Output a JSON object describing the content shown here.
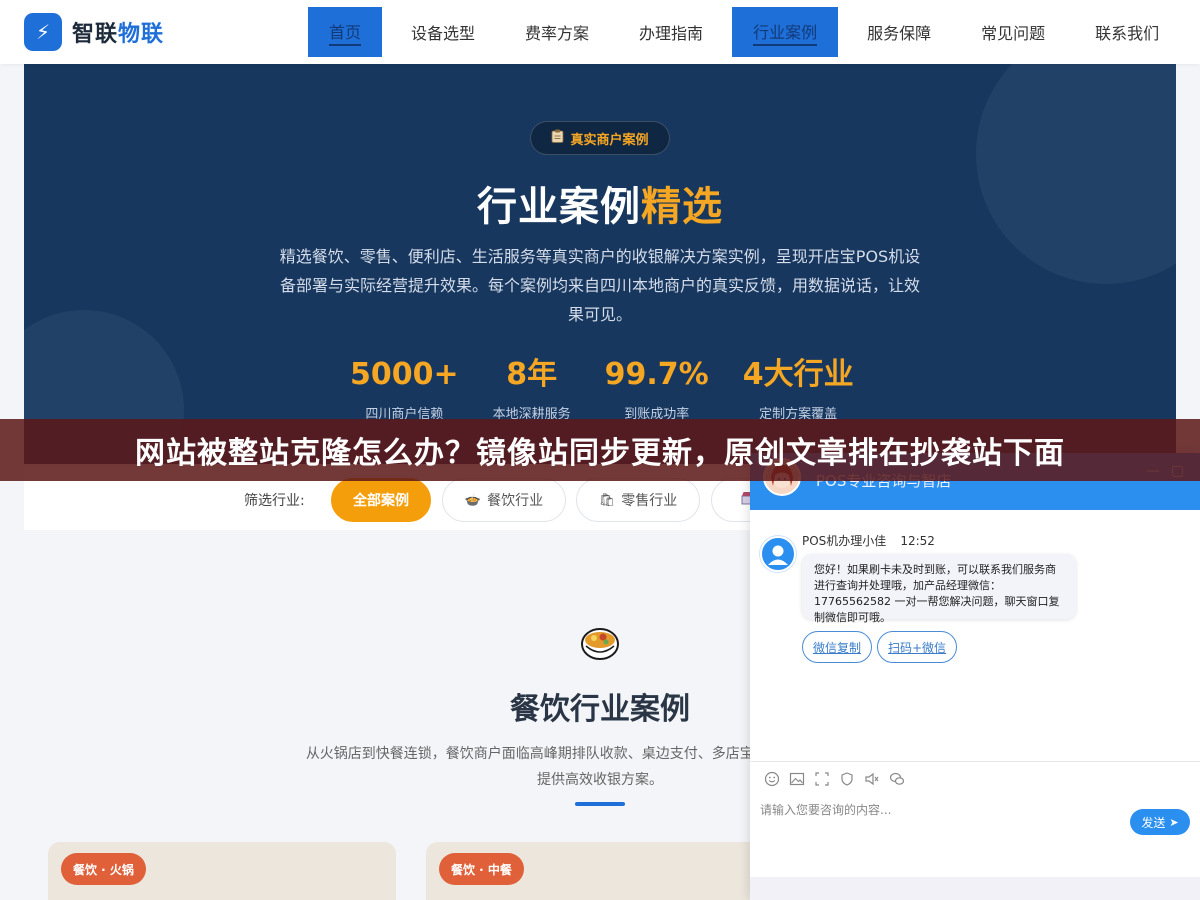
{
  "logo": {
    "mark": "⚡",
    "text_main": "智联",
    "text_accent": "物联"
  },
  "nav": [
    {
      "label": "首页",
      "active": true
    },
    {
      "label": "设备选型",
      "active": false
    },
    {
      "label": "费率方案",
      "active": false
    },
    {
      "label": "办理指南",
      "active": false
    },
    {
      "label": "行业案例",
      "active": true
    },
    {
      "label": "服务保障",
      "active": false
    },
    {
      "label": "常见问题",
      "active": false
    },
    {
      "label": "联系我们",
      "active": false
    }
  ],
  "hero": {
    "badge": "真实商户案例",
    "title_main": "行业案例",
    "title_highlight": "精选",
    "desc": "精选餐饮、零售、便利店、生活服务等真实商户的收银解决方案实例，呈现开店宝POS机设备部署与实际经营提升效果。每个案例均来自四川本地商户的真实反馈，用数据说话，让效果可见。",
    "stats": [
      {
        "value": "5000+",
        "label": "四川商户信赖"
      },
      {
        "value": "8年",
        "label": "本地深耕服务"
      },
      {
        "value": "99.7%",
        "label": "到账成功率"
      },
      {
        "value": "4大行业",
        "label": "定制方案覆盖"
      }
    ]
  },
  "filter": {
    "label": "筛选行业:",
    "chips": [
      {
        "label": "全部案例",
        "icon": "",
        "active": true
      },
      {
        "label": "餐饮行业",
        "icon": "🍲",
        "active": false
      },
      {
        "label": "零售行业",
        "icon": "🛍",
        "active": false
      }
    ]
  },
  "section": {
    "title": "餐饮行业案例",
    "desc": "从火锅店到快餐连锁，餐饮商户面临高峰期排队收款、桌边支付、多店宝POS机为各类餐饮门店提供高效收银方案。"
  },
  "cards": [
    {
      "tag": "餐饮 · 火锅"
    },
    {
      "tag": "餐饮 · 中餐"
    }
  ],
  "banner": {
    "text": "网站被整站克隆怎么办？镜像站同步更新，原创文章排在抄袭站下面"
  },
  "chat": {
    "title": "POS专业咨询与智店",
    "minimize": "—",
    "maximize": "▢",
    "agent_name": "POS机办理小佳",
    "time": "12:52",
    "message": "您好！如果刷卡未及时到账，可以联系我们服务商进行查询并处理哦，加产品经理微信：17765562582 一对一帮您解决问题，聊天窗口复制微信即可哦。",
    "quick_buttons": [
      "微信复制",
      "扫码+微信"
    ],
    "input_placeholder": "请输入您要咨询的内容...",
    "send": "发送"
  }
}
